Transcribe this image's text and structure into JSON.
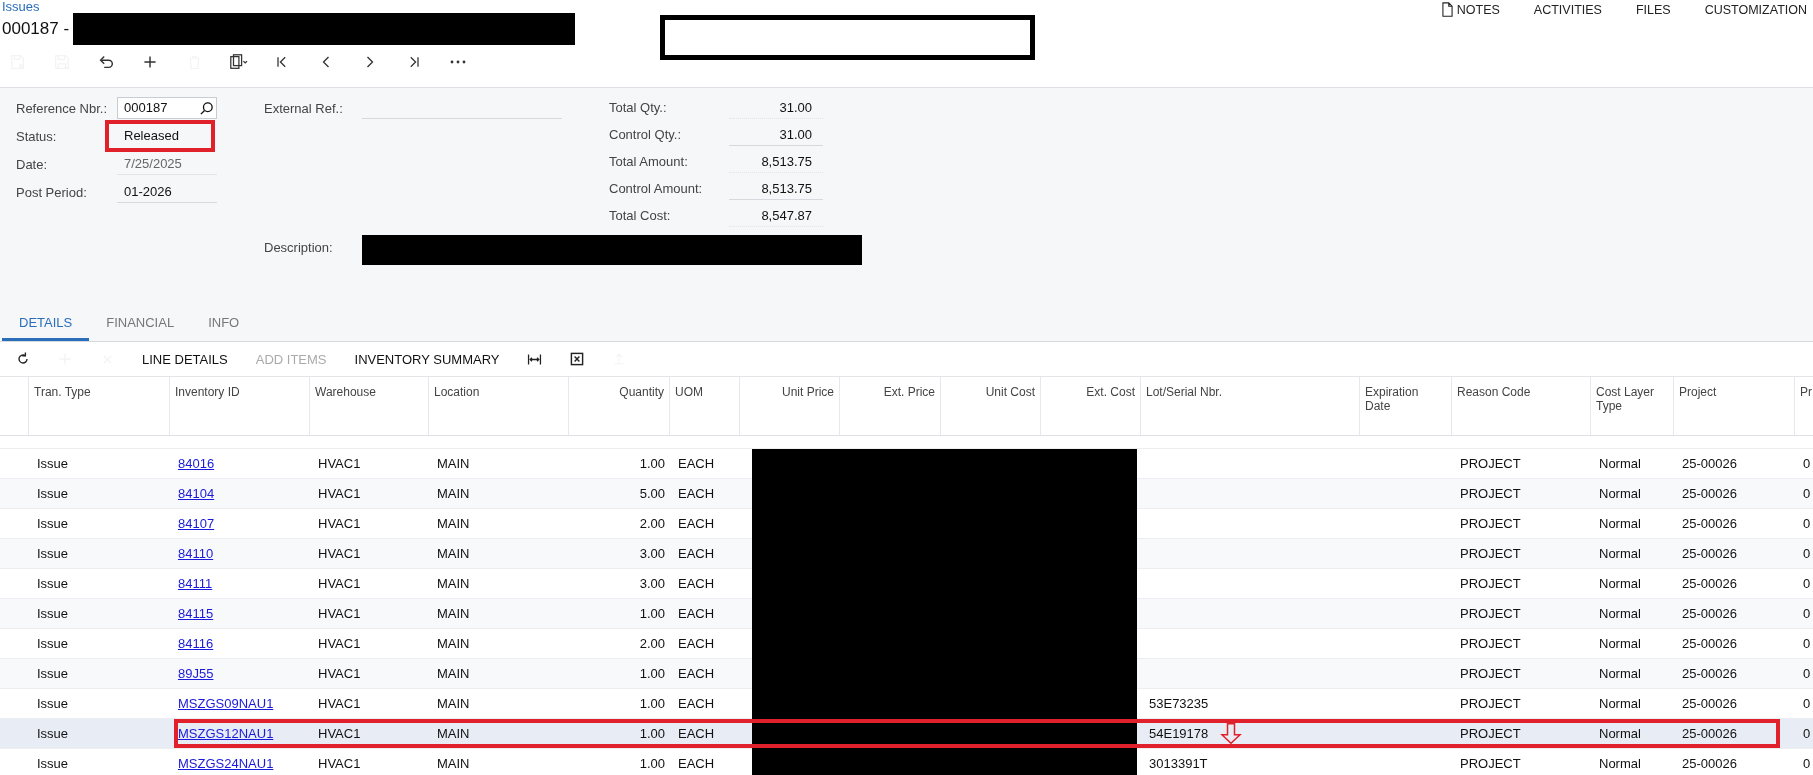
{
  "breadcrumb": "Issues",
  "title": "000187 -",
  "toolbar": [
    {
      "kind": "save-close",
      "disabled": true
    },
    {
      "kind": "save",
      "disabled": true
    },
    {
      "kind": "undo",
      "disabled": false
    },
    {
      "kind": "add",
      "disabled": false
    },
    {
      "kind": "delete",
      "disabled": true
    },
    {
      "kind": "clipboard",
      "disabled": false
    },
    {
      "kind": "first",
      "disabled": false
    },
    {
      "kind": "prev",
      "disabled": false
    },
    {
      "kind": "next",
      "disabled": false
    },
    {
      "kind": "last",
      "disabled": false
    },
    {
      "kind": "more",
      "disabled": false
    }
  ],
  "header_links": [
    {
      "label": "NOTES",
      "kind": "note"
    },
    {
      "label": "ACTIVITIES",
      "kind": "text"
    },
    {
      "label": "FILES",
      "kind": "text"
    },
    {
      "label": "CUSTOMIZATION",
      "kind": "text"
    }
  ],
  "form": {
    "fields": [
      {
        "label": "Reference Nbr.:",
        "value": "000187",
        "kind": "lookup",
        "outlined": false
      },
      {
        "label": "Status:",
        "value": "Released",
        "kind": "plain",
        "outlined": true
      },
      {
        "label": "Date:",
        "value": "7/25/2025",
        "kind": "readonly",
        "outlined": false
      },
      {
        "label": "Post Period:",
        "value": "01-2026",
        "kind": "text",
        "outlined": false
      }
    ],
    "external_ref": {
      "label": "External Ref.:"
    },
    "description": {
      "label": "Description:"
    },
    "totals": [
      {
        "label": "Total Qty.:",
        "value": "31.00",
        "kind": "readonly"
      },
      {
        "label": "Control Qty.:",
        "value": "31.00",
        "kind": "text"
      },
      {
        "label": "Total Amount:",
        "value": "8,513.75",
        "kind": "readonly"
      },
      {
        "label": "Control Amount:",
        "value": "8,513.75",
        "kind": "text"
      },
      {
        "label": "Total Cost:",
        "value": "8,547.87",
        "kind": "readonly"
      }
    ]
  },
  "tabs": [
    {
      "label": "DETAILS",
      "selected": true
    },
    {
      "label": "FINANCIAL",
      "selected": false
    },
    {
      "label": "INFO",
      "selected": false
    }
  ],
  "grid_toolbar": [
    {
      "kind": "refresh",
      "disabled": false
    },
    {
      "kind": "add",
      "disabled": true
    },
    {
      "kind": "close",
      "disabled": true
    },
    {
      "kind": "text",
      "label": "LINE DETAILS",
      "disabled": false
    },
    {
      "kind": "text",
      "label": "ADD ITEMS",
      "disabled": true
    },
    {
      "kind": "text",
      "label": "INVENTORY SUMMARY",
      "disabled": false
    },
    {
      "kind": "fit",
      "disabled": false
    },
    {
      "kind": "excel",
      "disabled": false
    },
    {
      "kind": "upload",
      "disabled": true
    }
  ],
  "columns": [
    {
      "label": "Tran. Type",
      "kind": "text"
    },
    {
      "label": "Inventory ID",
      "kind": "link"
    },
    {
      "label": "Warehouse",
      "kind": "text"
    },
    {
      "label": "Location",
      "kind": "text"
    },
    {
      "label": "Quantity",
      "kind": "number"
    },
    {
      "label": "UOM",
      "kind": "text"
    },
    {
      "label": "Unit Price",
      "kind": "redacted"
    },
    {
      "label": "Ext. Price",
      "kind": "redacted"
    },
    {
      "label": "Unit Cost",
      "kind": "redacted"
    },
    {
      "label": "Ext. Cost",
      "kind": "redacted"
    },
    {
      "label": "Lot/Serial Nbr.",
      "kind": "text"
    },
    {
      "label": "Expiration Date",
      "kind": "text"
    },
    {
      "label": "Reason Code",
      "kind": "text"
    },
    {
      "label": "Cost Layer Type",
      "kind": "text"
    },
    {
      "label": "Project",
      "kind": "text"
    },
    {
      "label": "Pr",
      "kind": "text"
    }
  ],
  "rows": [
    {
      "selected": false,
      "outlined": false,
      "arrow": false,
      "tran_type": "Issue",
      "inventory_id": "84016",
      "warehouse": "HVAC1",
      "location": "MAIN",
      "quantity": "1.00",
      "uom": "EACH",
      "reason_code": "PROJECT",
      "cost_layer_type": "Normal",
      "project": "25-00026",
      "column_16": "0"
    },
    {
      "selected": false,
      "outlined": false,
      "arrow": false,
      "tran_type": "Issue",
      "inventory_id": "84104",
      "warehouse": "HVAC1",
      "location": "MAIN",
      "quantity": "5.00",
      "uom": "EACH",
      "reason_code": "PROJECT",
      "cost_layer_type": "Normal",
      "project": "25-00026",
      "column_16": "0"
    },
    {
      "selected": false,
      "outlined": false,
      "arrow": false,
      "tran_type": "Issue",
      "inventory_id": "84107",
      "warehouse": "HVAC1",
      "location": "MAIN",
      "quantity": "2.00",
      "uom": "EACH",
      "reason_code": "PROJECT",
      "cost_layer_type": "Normal",
      "project": "25-00026",
      "column_16": "0"
    },
    {
      "selected": false,
      "outlined": false,
      "arrow": false,
      "tran_type": "Issue",
      "inventory_id": "84110",
      "warehouse": "HVAC1",
      "location": "MAIN",
      "quantity": "3.00",
      "uom": "EACH",
      "reason_code": "PROJECT",
      "cost_layer_type": "Normal",
      "project": "25-00026",
      "column_16": "0"
    },
    {
      "selected": false,
      "outlined": false,
      "arrow": false,
      "tran_type": "Issue",
      "inventory_id": "84111",
      "warehouse": "HVAC1",
      "location": "MAIN",
      "quantity": "3.00",
      "uom": "EACH",
      "reason_code": "PROJECT",
      "cost_layer_type": "Normal",
      "project": "25-00026",
      "column_16": "0"
    },
    {
      "selected": false,
      "outlined": false,
      "arrow": false,
      "tran_type": "Issue",
      "inventory_id": "84115",
      "warehouse": "HVAC1",
      "location": "MAIN",
      "quantity": "1.00",
      "uom": "EACH",
      "reason_code": "PROJECT",
      "cost_layer_type": "Normal",
      "project": "25-00026",
      "column_16": "0"
    },
    {
      "selected": false,
      "outlined": false,
      "arrow": false,
      "tran_type": "Issue",
      "inventory_id": "84116",
      "warehouse": "HVAC1",
      "location": "MAIN",
      "quantity": "2.00",
      "uom": "EACH",
      "reason_code": "PROJECT",
      "cost_layer_type": "Normal",
      "project": "25-00026",
      "column_16": "0"
    },
    {
      "selected": false,
      "outlined": false,
      "arrow": false,
      "tran_type": "Issue",
      "inventory_id": "89J55",
      "warehouse": "HVAC1",
      "location": "MAIN",
      "quantity": "1.00",
      "uom": "EACH",
      "reason_code": "PROJECT",
      "cost_layer_type": "Normal",
      "project": "25-00026",
      "column_16": "0"
    },
    {
      "selected": false,
      "outlined": false,
      "arrow": false,
      "tran_type": "Issue",
      "inventory_id": "MSZGS09NAU1",
      "warehouse": "HVAC1",
      "location": "MAIN",
      "quantity": "1.00",
      "uom": "EACH",
      "lot_serial_nbr": "53E73235",
      "reason_code": "PROJECT",
      "cost_layer_type": "Normal",
      "project": "25-00026",
      "column_16": "0"
    },
    {
      "selected": true,
      "outlined": true,
      "arrow": true,
      "tran_type": "Issue",
      "inventory_id": "MSZGS12NAU1",
      "warehouse": "HVAC1",
      "location": "MAIN",
      "quantity": "1.00",
      "uom": "EACH",
      "lot_serial_nbr": "54E19178",
      "reason_code": "PROJECT",
      "cost_layer_type": "Normal",
      "project": "25-00026",
      "column_16": "0"
    },
    {
      "selected": false,
      "outlined": false,
      "arrow": false,
      "tran_type": "Issue",
      "inventory_id": "MSZGS24NAU1",
      "warehouse": "HVAC1",
      "location": "MAIN",
      "quantity": "1.00",
      "uom": "EACH",
      "lot_serial_nbr": "3013391T",
      "reason_code": "PROJECT",
      "cost_layer_type": "Normal",
      "project": "25-00026",
      "column_16": "0"
    }
  ]
}
